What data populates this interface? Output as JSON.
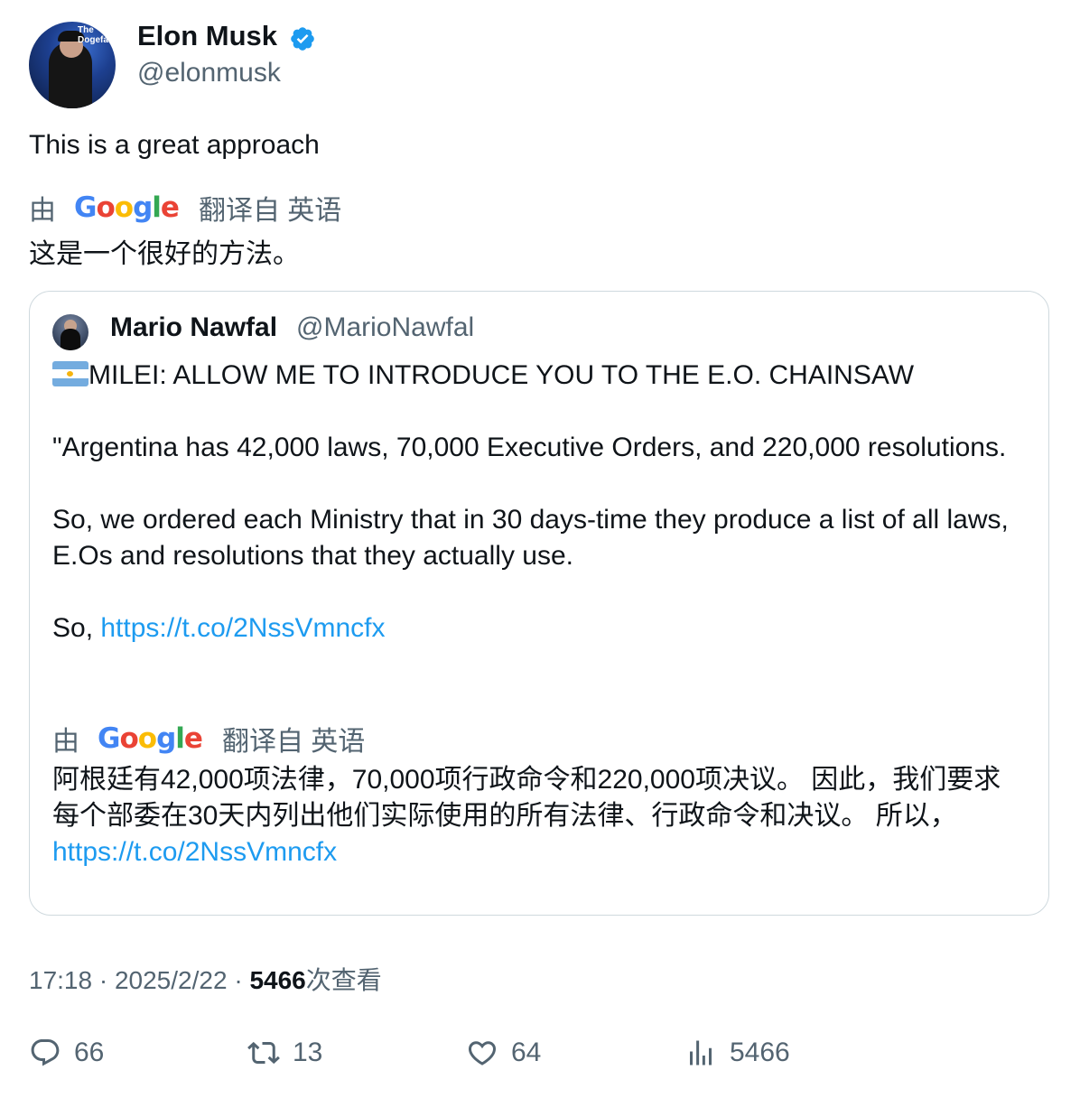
{
  "author": {
    "name": "Elon Musk",
    "handle": "@elonmusk",
    "verified_icon": "verified-badge-icon",
    "avatar_sign": "The Dogefa"
  },
  "tweet": {
    "text": "This is a great approach",
    "translation_prefix": "由",
    "translation_provider": "Google",
    "translation_suffix": "翻译自 英语",
    "translated_text": "这是一个很好的方法。"
  },
  "quote": {
    "name": "Mario Nawfal",
    "handle": "@MarioNawfal",
    "flag_icon": "argentina-flag-icon",
    "headline": "MILEI: ALLOW ME TO INTRODUCE YOU TO THE E.O. CHAINSAW",
    "para1": "\"Argentina has 42,000 laws, 70,000 Executive Orders, and 220,000 resolutions.",
    "para2": "So, we ordered each Ministry that in 30 days-time they produce a list of all laws, E.Os and resolutions that they actually use.",
    "para3_prefix": "So, ",
    "link": "https://t.co/2NssVmncfx",
    "translation_prefix": "由",
    "translation_provider": "Google",
    "translation_suffix": "翻译自 英语",
    "translated_text": "阿根廷有42,000项法律，70,000项行政命令和220,000项决议。 因此，我们要求每个部委在30天内列出他们实际使用的所有法律、行政命令和决议。 所以，",
    "translated_link": "https://t.co/2NssVmncfx"
  },
  "meta": {
    "time": "17:18",
    "sep1": " · ",
    "date": "2025/2/22",
    "sep2": " · ",
    "views": "5466",
    "views_label": "次查看"
  },
  "actions": {
    "replies": "66",
    "retweets": "13",
    "likes": "64",
    "views": "5466"
  }
}
